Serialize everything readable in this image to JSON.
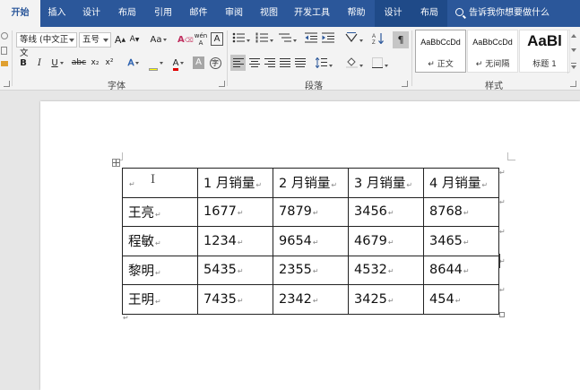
{
  "tabs": [
    {
      "label": "开始",
      "active": true
    },
    {
      "label": "插入"
    },
    {
      "label": "设计"
    },
    {
      "label": "布局"
    },
    {
      "label": "引用"
    },
    {
      "label": "邮件"
    },
    {
      "label": "审阅"
    },
    {
      "label": "视图"
    },
    {
      "label": "开发工具"
    },
    {
      "label": "帮助"
    },
    {
      "label": "设计",
      "contextual": true
    },
    {
      "label": "布局",
      "contextual": true
    }
  ],
  "tell_me": "告诉我你想要做什么",
  "ribbon": {
    "font": {
      "name": "等线 (中文正文",
      "size": "五号",
      "group_label": "字体",
      "grow": "A",
      "shrink": "A",
      "change_case": "Aa",
      "bold": "B",
      "italic": "I",
      "underline": "U",
      "strike": "abc",
      "subscript": "x₂",
      "superscript": "x²",
      "text_effect": "A",
      "font_color": "A",
      "char_shade": "A",
      "phonetic": "wén",
      "char_border": "A"
    },
    "paragraph": {
      "group_label": "段落"
    },
    "styles": {
      "group_label": "样式",
      "items": [
        {
          "preview": "AaBbCcDd",
          "name": "↵ 正文"
        },
        {
          "preview": "AaBbCcDd",
          "name": "↵ 无间隔"
        },
        {
          "preview": "AaBl",
          "name": "标题 1"
        }
      ]
    }
  },
  "table": {
    "rows": [
      [
        "",
        "1 月销量",
        "2 月销量",
        "3 月销量",
        "4 月销量"
      ],
      [
        "王亮",
        "1677",
        "7879",
        "3456",
        "8768"
      ],
      [
        "程敏",
        "1234",
        "9654",
        "4679",
        "3465"
      ],
      [
        "黎明",
        "5435",
        "2355",
        "4532",
        "8644"
      ],
      [
        "王明",
        "7435",
        "2342",
        "3425",
        "454"
      ]
    ]
  },
  "colors": {
    "accent": "#2b579a",
    "ribbon_bg": "#f3f3f3",
    "canvas_bg": "#e6e6e6",
    "highlight_yellow": "#ffff00",
    "font_red": "#e00000"
  }
}
